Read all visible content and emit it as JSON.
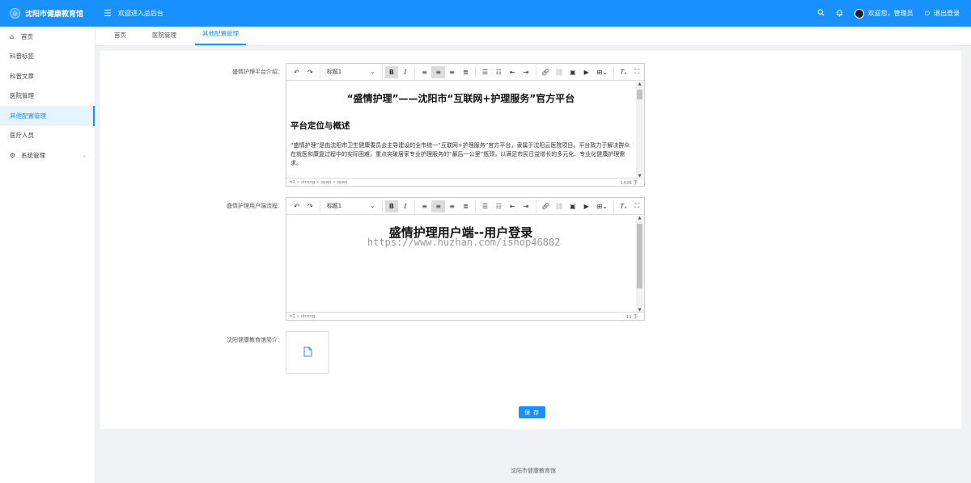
{
  "header": {
    "app_title": "沈阳市健康教育馆",
    "welcome": "欢迎进入总后台",
    "user_greeting": "欢迎您，管理员",
    "logout": "退出登录"
  },
  "sidebar": {
    "items": [
      {
        "label": "首页"
      },
      {
        "label": "科普标签"
      },
      {
        "label": "科普文章"
      },
      {
        "label": "医院管理"
      },
      {
        "label": "其他配置管理"
      },
      {
        "label": "医疗人员"
      },
      {
        "label": "系统管理"
      }
    ]
  },
  "tabs": [
    {
      "label": "首页"
    },
    {
      "label": "医院管理"
    },
    {
      "label": "其他配置管理"
    }
  ],
  "form": {
    "field1_label": "盛情护理平台介绍：",
    "field2_label": "盛情护理用户端流程：",
    "field3_label": "沈阳健康教育馆简介：",
    "save_label": "保 存"
  },
  "editor_common": {
    "heading_select": "标题1"
  },
  "editor1": {
    "title": "“盛情护理”——沈阳市“互联网+护理服务”官方平台",
    "section": "平台定位与概述",
    "paragraph": "“盛情护理”是由沈阳市卫生健康委员会主导建设的全市统一“互联网+护理服务”官方平台，隶属于沈阳云医院项目。平台致力于解决群众在就医和康复过程中的实际困难，重点突破居家专业护理服务的“最后一公里”瓶颈，以满足市民日益增长的多元化、专业化健康护理需求。",
    "path": "h1 » strong » span » span",
    "count": "1438 字"
  },
  "editor2": {
    "title": "盛情护理用户端--用户登录",
    "watermark": "https://www.huzhan.com/ishop46882",
    "path": "h1 » strong",
    "count": "11 字"
  },
  "footer": {
    "text": "沈阳市健康教育馆"
  }
}
